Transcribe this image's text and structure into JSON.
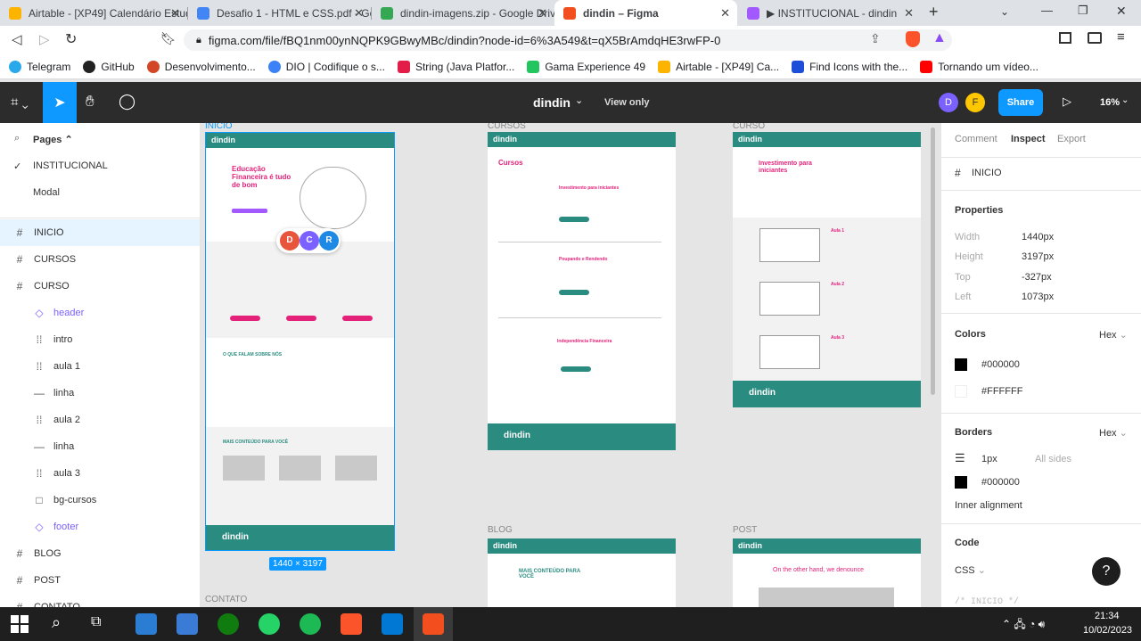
{
  "browser": {
    "tabs": [
      {
        "label": "Airtable - [XP49] Calendário Estud",
        "color": "#fcb400"
      },
      {
        "label": "Desafio 1 - HTML e CSS.pdf - Goo",
        "color": "#4285f4"
      },
      {
        "label": "dindin-imagens.zip - Google Drive",
        "color": "#34a853"
      },
      {
        "label": "dindin – Figma",
        "color": "#f24e1e"
      },
      {
        "label": "▶ INSTITUCIONAL - dindin",
        "color": "#a259ff"
      }
    ],
    "url": "figma.com/file/fBQ1nm00ynNQPK9GBwyMBc/dindin?node-id=6%3A549&t=qX5BrAmdqHE3rwFP-0",
    "bookmarks": [
      {
        "label": "Telegram",
        "color": "#29a9eb"
      },
      {
        "label": "GitHub",
        "color": "#222222"
      },
      {
        "label": "Desenvolvimento...",
        "color": "#d24726"
      },
      {
        "label": "DIO | Codifique o s...",
        "color": "#3b82f6"
      },
      {
        "label": "String (Java Platfor...",
        "color": "#e11d48"
      },
      {
        "label": "Gama Experience 49",
        "color": "#22c55e"
      },
      {
        "label": "Airtable - [XP49] Ca...",
        "color": "#fcb400"
      },
      {
        "label": "Find Icons with the...",
        "color": "#1d4ed8"
      },
      {
        "label": "Tornando um vídeo...",
        "color": "#ff0000"
      }
    ]
  },
  "figma": {
    "file_name": "dindin",
    "view_mode": "View only",
    "share_label": "Share",
    "zoom": "16%",
    "avatars": [
      {
        "letter": "D",
        "color": "#7b61ff"
      },
      {
        "letter": "F",
        "color": "#ffc700"
      }
    ],
    "pages_label": "Pages",
    "pages": [
      "INSTITUCIONAL",
      "Modal"
    ],
    "layers": [
      {
        "icon": "#",
        "label": "INICIO",
        "level": 0
      },
      {
        "icon": "#",
        "label": "CURSOS",
        "level": 0
      },
      {
        "icon": "#",
        "label": "CURSO",
        "level": 0
      },
      {
        "icon": "◇",
        "label": "header",
        "level": 1
      },
      {
        "icon": "⁞⁞",
        "label": "intro",
        "level": 1
      },
      {
        "icon": "⁞⁞",
        "label": "aula 1",
        "level": 1
      },
      {
        "icon": "—",
        "label": "linha",
        "level": 1
      },
      {
        "icon": "⁞⁞",
        "label": "aula 2",
        "level": 1
      },
      {
        "icon": "—",
        "label": "linha",
        "level": 1
      },
      {
        "icon": "⁞⁞",
        "label": "aula 3",
        "level": 1
      },
      {
        "icon": "□",
        "label": "bg-cursos",
        "level": 1
      },
      {
        "icon": "◇",
        "label": "footer",
        "level": 1
      },
      {
        "icon": "#",
        "label": "BLOG",
        "level": 0
      },
      {
        "icon": "#",
        "label": "POST",
        "level": 0
      },
      {
        "icon": "#",
        "label": "CONTATO",
        "level": 0
      }
    ],
    "canvas": {
      "frame_labels": [
        "INICIO",
        "CURSOS",
        "CURSO",
        "BLOG",
        "POST",
        "CONTATO"
      ],
      "size_badge": "1440 × 3197",
      "collaborators": [
        {
          "letter": "D",
          "color": "#e8553d"
        },
        {
          "letter": "C",
          "color": "#7b61ff"
        },
        {
          "letter": "R",
          "color": "#1e88e5"
        }
      ],
      "logo": "dindin",
      "inicio": {
        "hero_title": "Educação Financeira é tudo de bom",
        "testimonials_title": "O QUE FALAM SOBRE NÓS",
        "more_title": "MAIS CONTEÚDO PARA VOCÊ"
      },
      "cursos": {
        "title": "Cursos",
        "items": [
          "Investimento para iniciantes",
          "Poupando e Rendendo",
          "Independência Financeira"
        ]
      },
      "curso": {
        "title": "Investimento para iniciantes",
        "lessons": [
          "Aula 1",
          "Aula 2",
          "Aula 3"
        ]
      },
      "blog": {
        "title": "MAIS CONTEÚDO PARA VOCÊ"
      },
      "post": {
        "title": "On the other hand, we denounce"
      }
    },
    "inspect": {
      "tabs": [
        "Comment",
        "Inspect",
        "Export"
      ],
      "active_tab": "Inspect",
      "selection": "INICIO",
      "properties_title": "Properties",
      "properties": [
        {
          "key": "Width",
          "value": "1440px"
        },
        {
          "key": "Height",
          "value": "3197px"
        },
        {
          "key": "Top",
          "value": "-327px"
        },
        {
          "key": "Left",
          "value": "1073px"
        }
      ],
      "colors_title": "Colors",
      "colors_format": "Hex",
      "colors": [
        {
          "hex": "#000000"
        },
        {
          "hex": "#FFFFFF"
        }
      ],
      "borders_title": "Borders",
      "borders_format": "Hex",
      "border_width": "1px",
      "border_sides": "All sides",
      "border_color": "#000000",
      "inner_alignment": "Inner alignment",
      "code_title": "Code",
      "code_lang": "CSS",
      "code_comment": "/* INICIO */"
    }
  },
  "taskbar": {
    "time": "21:34",
    "date": "10/02/2023"
  }
}
